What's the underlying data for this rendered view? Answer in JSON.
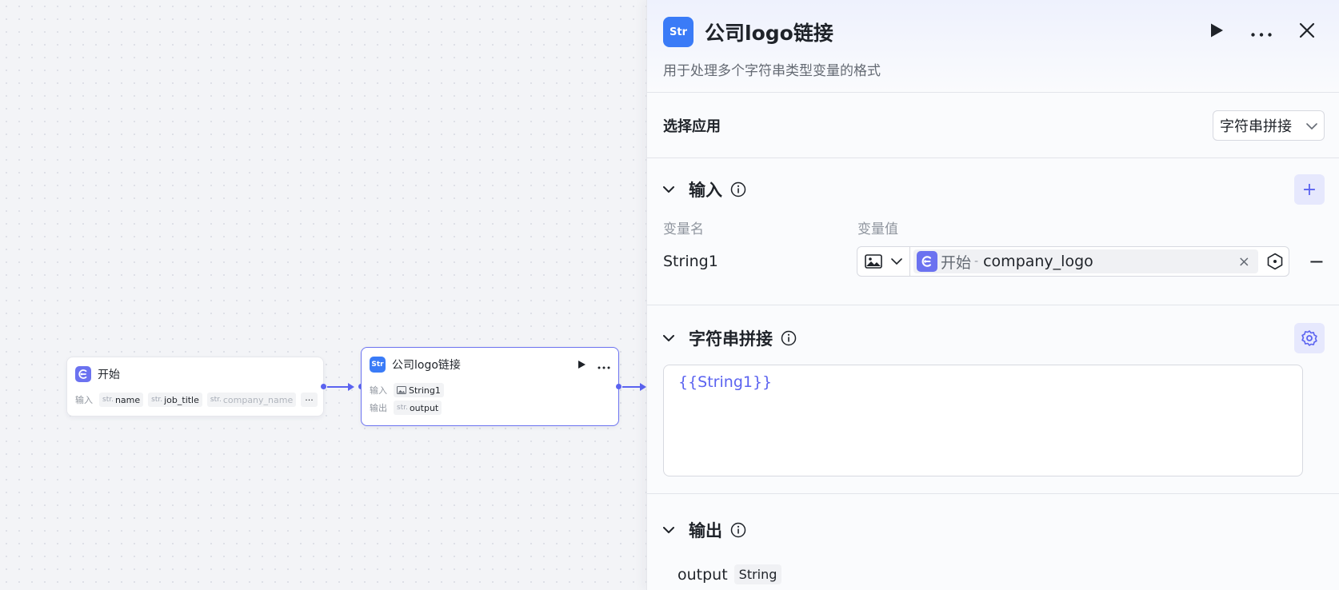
{
  "canvas": {
    "start_node": {
      "title": "开始",
      "input_label": "输入",
      "params": [
        {
          "type": "str.",
          "name": "name"
        },
        {
          "type": "str.",
          "name": "job_title"
        },
        {
          "type": "str.",
          "name": "company_name"
        }
      ],
      "more": "···"
    },
    "concat_node": {
      "icon": "Str",
      "title": "公司logo链接",
      "input_label": "输入",
      "input_name": "String1",
      "output_label": "输出",
      "output_type": "str.",
      "output_name": "output"
    }
  },
  "panel": {
    "icon": "Str",
    "title": "公司logo链接",
    "description": "用于处理多个字符串类型变量的格式",
    "app_section": {
      "label": "选择应用",
      "selected": "字符串拼接"
    },
    "input_section": {
      "title": "输入",
      "add": "+",
      "col_name": "变量名",
      "col_value": "变量值",
      "rows": [
        {
          "name": "String1",
          "source": "开始",
          "separator": "-",
          "variable": "company_logo",
          "clear": "×",
          "remove": "−"
        }
      ]
    },
    "concat_section": {
      "title": "字符串拼接",
      "template": "{{String1}}"
    },
    "output_section": {
      "title": "输出",
      "name": "output",
      "type": "String"
    }
  },
  "colors": {
    "accent": "#5b63f0",
    "str_icon": "#3a7bf7"
  }
}
